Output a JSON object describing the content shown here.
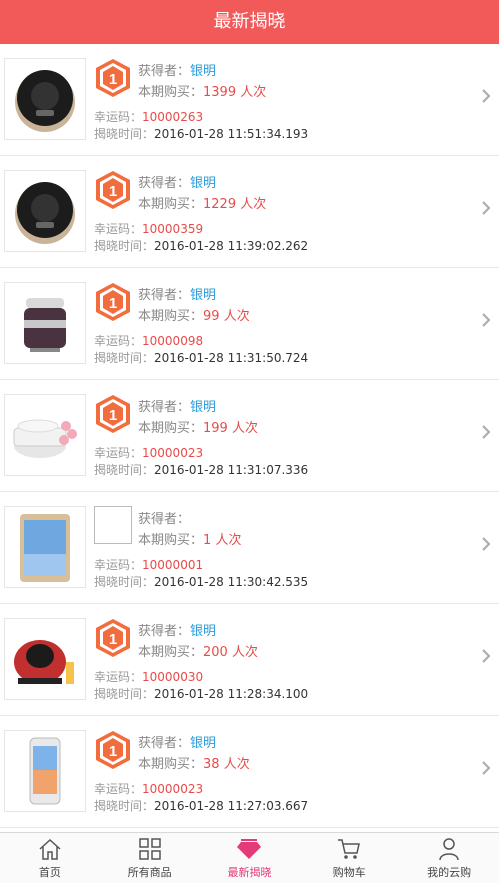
{
  "header": {
    "title": "最新揭晓"
  },
  "labels": {
    "winner": "获得者：",
    "purchase": "本期购买：",
    "times_unit": "人次",
    "lucky_code": "幸运码：",
    "reveal_time": "揭晓时间："
  },
  "items": [
    {
      "product": "robot-vacuum",
      "badge": "1",
      "winner": "银明",
      "count": "1399",
      "code": "10000263",
      "time": "2016-01-28 11:51:34.193"
    },
    {
      "product": "robot-vacuum",
      "badge": "1",
      "winner": "银明",
      "count": "1229",
      "code": "10000359",
      "time": "2016-01-28 11:39:02.262"
    },
    {
      "product": "lunch-box",
      "badge": "1",
      "winner": "银明",
      "count": "99",
      "code": "10000098",
      "time": "2016-01-28 11:31:50.724"
    },
    {
      "product": "yogurt-maker",
      "badge": "1",
      "winner": "银明",
      "count": "199",
      "code": "10000023",
      "time": "2016-01-28 11:31:07.336"
    },
    {
      "product": "tablet",
      "badge": "broken",
      "winner": "",
      "count": "1",
      "code": "10000001",
      "time": "2016-01-28 11:30:42.535"
    },
    {
      "product": "popcorn-machine",
      "badge": "1",
      "winner": "银明",
      "count": "200",
      "code": "10000030",
      "time": "2016-01-28 11:28:34.100"
    },
    {
      "product": "phone",
      "badge": "1",
      "winner": "银明",
      "count": "38",
      "code": "10000023",
      "time": "2016-01-28 11:27:03.667"
    }
  ],
  "tabbar": [
    {
      "label": "首页",
      "icon": "home-icon"
    },
    {
      "label": "所有商品",
      "icon": "grid-icon"
    },
    {
      "label": "最新揭晓",
      "icon": "diamond-icon",
      "active": true
    },
    {
      "label": "购物车",
      "icon": "cart-icon"
    },
    {
      "label": "我的云购",
      "icon": "user-icon"
    }
  ],
  "colors": {
    "header": "#f25a5a",
    "winner": "#2e9bd6",
    "accent": "#e84b4b",
    "badge": "#f26d3d",
    "active_tab": "#e53a78"
  }
}
